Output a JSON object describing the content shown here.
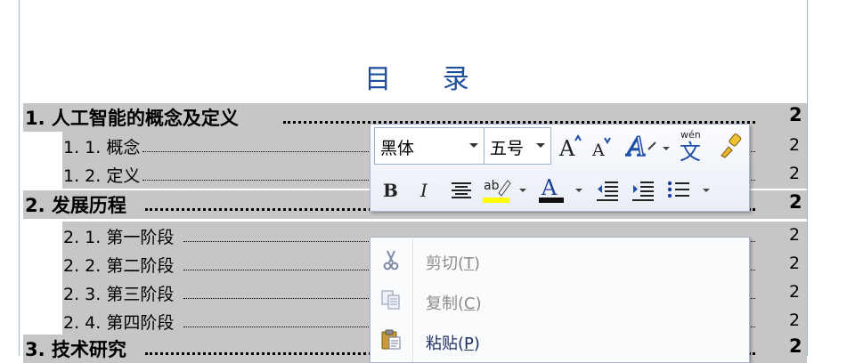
{
  "document": {
    "title": "目 录",
    "toc": [
      {
        "level": 1,
        "label": "1. 人工智能的概念及定义",
        "page": "2"
      },
      {
        "level": 2,
        "label": "1. 1. 概念",
        "page": "2"
      },
      {
        "level": 2,
        "label": "1. 2. 定义",
        "page": "2"
      },
      {
        "level": 1,
        "label": "2. 发展历程",
        "page": "2"
      },
      {
        "level": 2,
        "label": "2. 1. 第一阶段",
        "page": "2"
      },
      {
        "level": 2,
        "label": "2. 2. 第二阶段",
        "page": "2"
      },
      {
        "level": 2,
        "label": "2. 3. 第三阶段",
        "page": "2"
      },
      {
        "level": 2,
        "label": "2. 4. 第四阶段",
        "page": "2"
      },
      {
        "level": 1,
        "label": "3. 技术研究",
        "page": "2"
      }
    ]
  },
  "mini_toolbar": {
    "font_name": "黑体",
    "font_size": "五号",
    "buttons": [
      "grow-font",
      "shrink-font",
      "text-effects",
      "phonetic-guide",
      "format-painter",
      "bold",
      "italic",
      "center",
      "highlight",
      "font-color",
      "decrease-indent",
      "increase-indent",
      "bullets"
    ],
    "highlight_color": "#ffff00",
    "font_color": "#1f3fa0"
  },
  "context_menu": {
    "items": [
      {
        "label": "剪切(",
        "key": "T",
        "suffix": ")",
        "enabled": false,
        "icon": "scissors-icon"
      },
      {
        "label": "复制(",
        "key": "C",
        "suffix": ")",
        "enabled": false,
        "icon": "copy-icon"
      },
      {
        "label": "粘贴(",
        "key": "P",
        "suffix": ")",
        "enabled": true,
        "icon": "paste-icon"
      }
    ]
  },
  "colors": {
    "selection": "#c6c6c6",
    "title": "#1f4e9a",
    "menu_text": "#1f3060"
  }
}
